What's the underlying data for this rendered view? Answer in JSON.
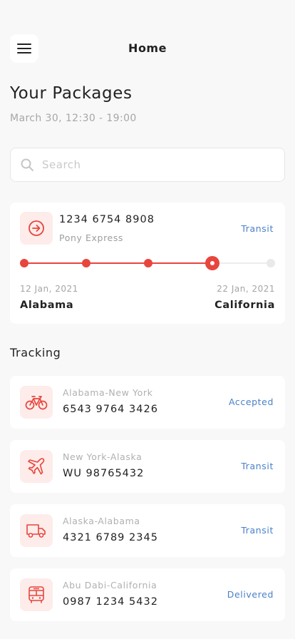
{
  "header": {
    "title": "Home",
    "menu_icon": "hamburger-menu-icon"
  },
  "page": {
    "title": "Your Packages",
    "subtitle": "March 30, 12:30 - 19:00"
  },
  "search": {
    "placeholder": "Search",
    "icon": "search-icon"
  },
  "main_package": {
    "icon": "arrow-right-circle-icon",
    "number": "1234 6754 8908",
    "carrier": "Pony Express",
    "status": "Transit",
    "start_date": "12 Jan, 2021",
    "end_date": "22 Jan, 2021",
    "origin": "Alabama",
    "destination": "California",
    "progress_steps_total": 5,
    "progress_current_step": 4
  },
  "tracking": {
    "title": "Tracking",
    "items": [
      {
        "icon": "bicycle-icon",
        "route": "Alabama-New York",
        "number": "6543 9764 3426",
        "status": "Accepted"
      },
      {
        "icon": "airplane-icon",
        "route": "New York-Alaska",
        "number": "WU 98765432",
        "status": "Transit"
      },
      {
        "icon": "truck-icon",
        "route": "Alaska-Alabama",
        "number": "4321 6789 2345",
        "status": "Transit"
      },
      {
        "icon": "bus-icon",
        "route": "Abu Dabi-California",
        "number": "0987 1234 5432",
        "status": "Delivered"
      }
    ]
  },
  "colors": {
    "accent": "#e8453c",
    "accent_light": "#fdecea",
    "status_blue": "#4a80c8",
    "background": "#f8f8f8"
  }
}
